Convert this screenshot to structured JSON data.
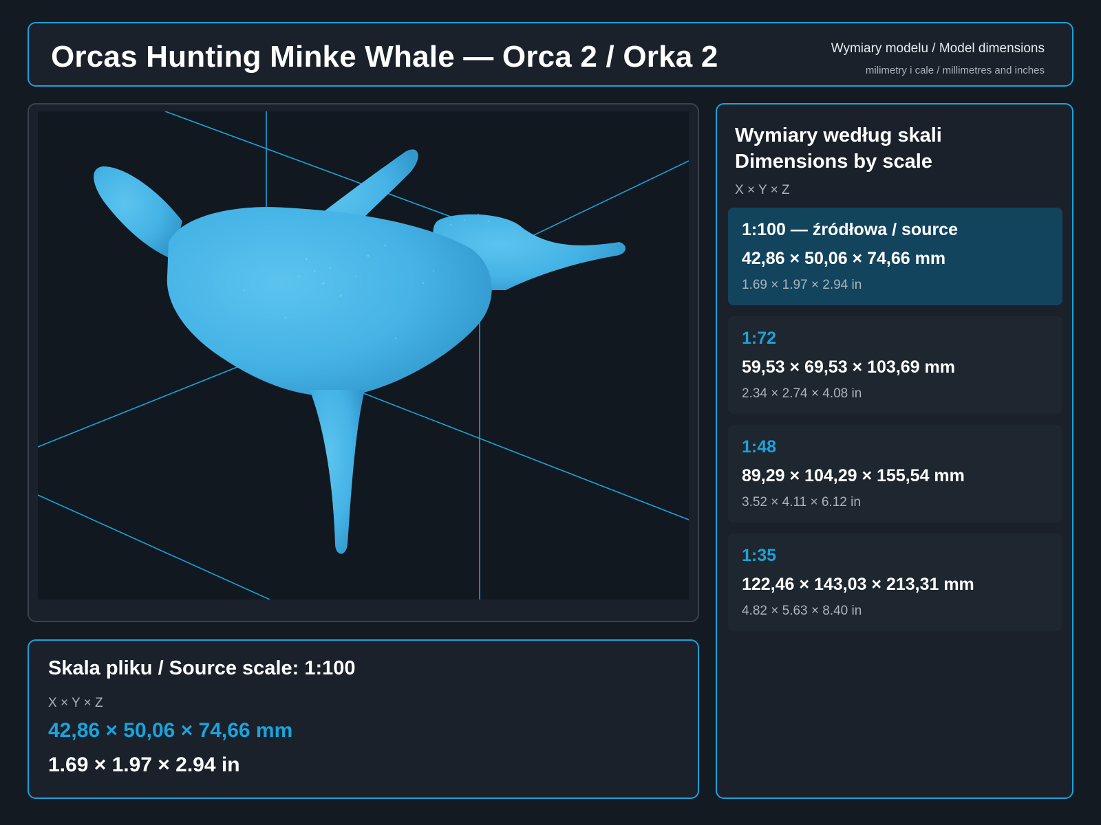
{
  "header": {
    "title": "Orcas Hunting Minke Whale — Orca 2 / Orka 2",
    "subtitle_primary": "Wymiary modelu / Model dimensions",
    "subtitle_secondary": "milimetry i cale / millimetres and inches"
  },
  "viewer": {
    "model_color": "#45b3e6",
    "grid_color": "#1aa3dc"
  },
  "source": {
    "title": "Skala pliku / Source scale: 1:100",
    "axes": "X × Y × Z",
    "mm": "42,86 × 50,06 × 74,66 mm",
    "in": "1.69 × 1.97 × 2.94 in"
  },
  "scales": {
    "title_line1": "Wymiary według skali",
    "title_line2": "Dimensions by scale",
    "axes": "X × Y × Z",
    "items": [
      {
        "name": "1:100  —  źródłowa / source",
        "mm": "42,86 × 50,06 × 74,66 mm",
        "in": "1.69 × 1.97 × 2.94 in",
        "active": true
      },
      {
        "name": "1:72",
        "mm": "59,53 × 69,53 × 103,69 mm",
        "in": "2.34 × 2.74 × 4.08 in",
        "active": false
      },
      {
        "name": "1:48",
        "mm": "89,29 × 104,29 × 155,54 mm",
        "in": "3.52 × 4.11 × 6.12 in",
        "active": false
      },
      {
        "name": "1:35",
        "mm": "122,46 × 143,03 × 213,31 mm",
        "in": "4.82 × 5.63 × 8.40 in",
        "active": false
      }
    ]
  }
}
